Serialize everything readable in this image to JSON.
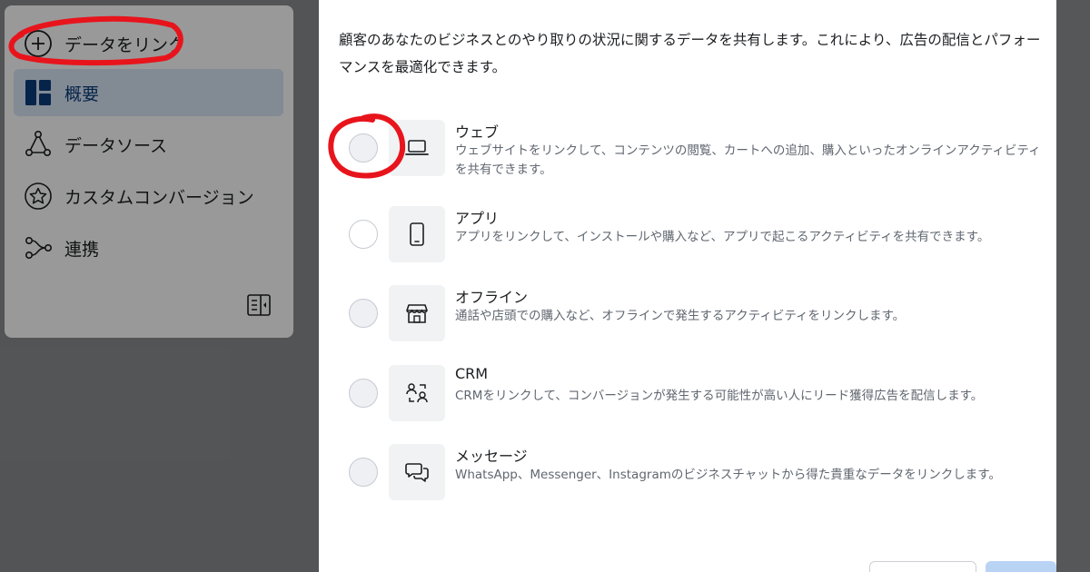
{
  "sidebar": {
    "link_data": "データをリンク",
    "items": [
      {
        "label": "概要",
        "icon": "dashboard-icon",
        "active": true
      },
      {
        "label": "データソース",
        "icon": "data-source-icon"
      },
      {
        "label": "カスタムコンバージョン",
        "icon": "star-badge-icon"
      },
      {
        "label": "連携",
        "icon": "integration-icon"
      }
    ]
  },
  "dialog": {
    "description": "顧客のあなたのビジネスとのやり取りの状況に関するデータを共有します。これにより、広告の配信とパフォーマンスを最適化できます。",
    "options": [
      {
        "title": "ウェブ",
        "desc": "ウェブサイトをリンクして、コンテンツの閲覧、カートへの追加、購入といったオンラインアクティビティを共有できます。",
        "icon": "laptop-icon"
      },
      {
        "title": "アプリ",
        "desc": "アプリをリンクして、インストールや購入など、アプリで起こるアクティビティを共有できます。",
        "icon": "mobile-icon"
      },
      {
        "title": "オフライン",
        "desc": "通話や店頭での購入など、オフラインで発生するアクティビティをリンクします。",
        "icon": "store-icon"
      },
      {
        "title": "CRM",
        "desc": "CRMをリンクして、コンバージョンが発生する可能性が高い人にリード獲得広告を配信します。",
        "icon": "crm-icon"
      },
      {
        "title": "メッセージ",
        "desc": "WhatsApp、Messenger、Instagramのビジネスチャットから得た貴重なデータをリンクします。",
        "icon": "chat-icon"
      }
    ]
  },
  "colors": {
    "accent": "#0a3c7a",
    "annotation": "#e8141c",
    "active_bg": "#d9e6f7"
  }
}
